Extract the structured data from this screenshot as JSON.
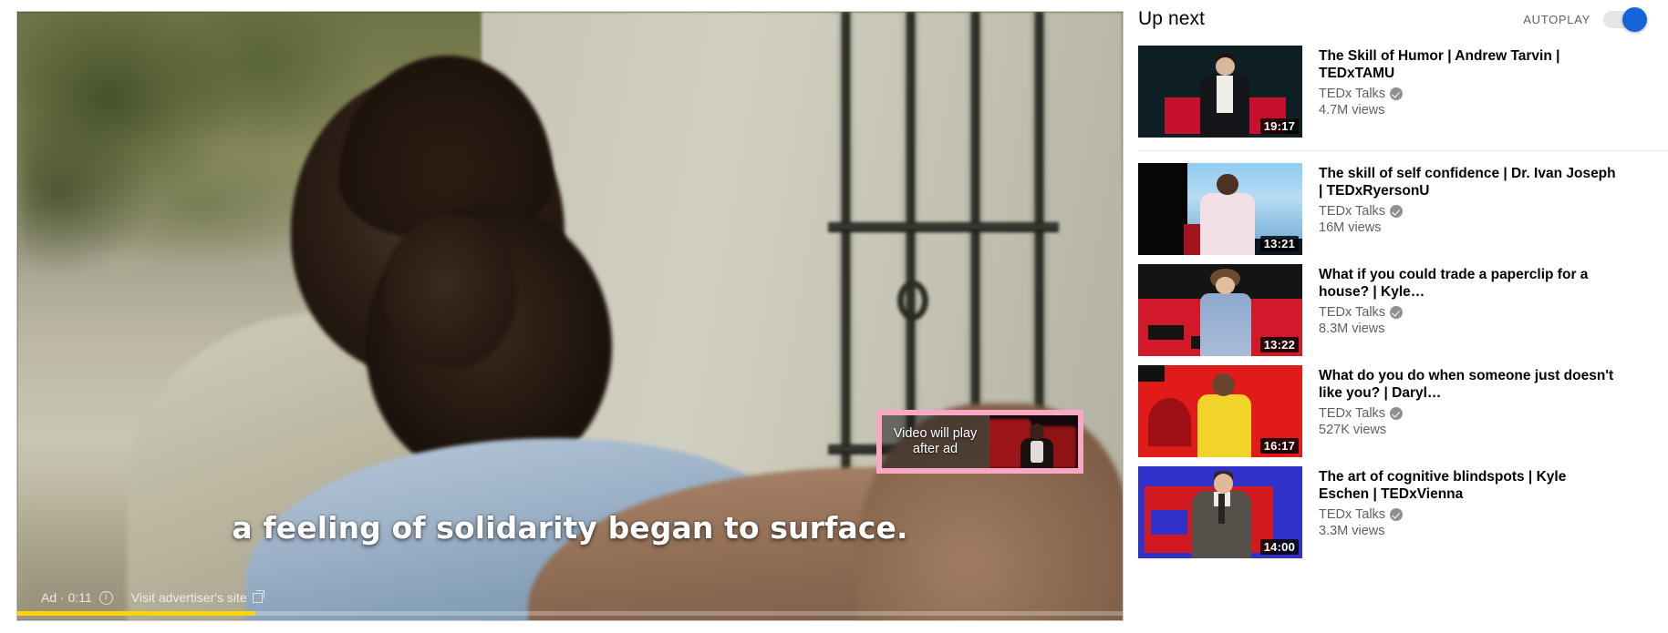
{
  "player": {
    "subtitle_text": "a feeling of solidarity began to surface.",
    "ad_label": "Ad · 0:11",
    "info_icon": "info-icon",
    "visit_site_label": "Visit advertiser's site",
    "external_link_icon": "external-link-icon",
    "progress_percent": 21.5,
    "progress_color": "#ffd400",
    "upnext_overlay": {
      "line1": "Video will play",
      "line2": "after ad",
      "highlight_color": "#f9a8c4"
    }
  },
  "sidebar": {
    "title": "Up next",
    "autoplay_label": "AUTOPLAY",
    "autoplay_on": true,
    "autoplay_color": "#1565d8",
    "videos": [
      {
        "title": "The Skill of Humor | Andrew Tarvin | TEDxTAMU",
        "channel": "TEDx Talks",
        "verified": true,
        "views": "4.7M views",
        "duration": "19:17",
        "thumb_class": "th1",
        "divider_after": true
      },
      {
        "title": "The skill of self confidence | Dr. Ivan Joseph | TEDxRyersonU",
        "channel": "TEDx Talks",
        "verified": true,
        "views": "16M views",
        "duration": "13:21",
        "thumb_class": "th2",
        "divider_after": false
      },
      {
        "title": "What if you could trade a paperclip for a house? | Kyle…",
        "channel": "TEDx Talks",
        "verified": true,
        "views": "8.3M views",
        "duration": "13:22",
        "thumb_class": "th3",
        "divider_after": false
      },
      {
        "title": "What do you do when someone just doesn't like you? | Daryl…",
        "channel": "TEDx Talks",
        "verified": true,
        "views": "527K views",
        "duration": "16:17",
        "thumb_class": "th4",
        "divider_after": false
      },
      {
        "title": "The art of cognitive blindspots | Kyle Eschen | TEDxVienna",
        "channel": "TEDx Talks",
        "verified": true,
        "views": "3.3M views",
        "duration": "14:00",
        "thumb_class": "th5",
        "divider_after": false
      }
    ]
  }
}
